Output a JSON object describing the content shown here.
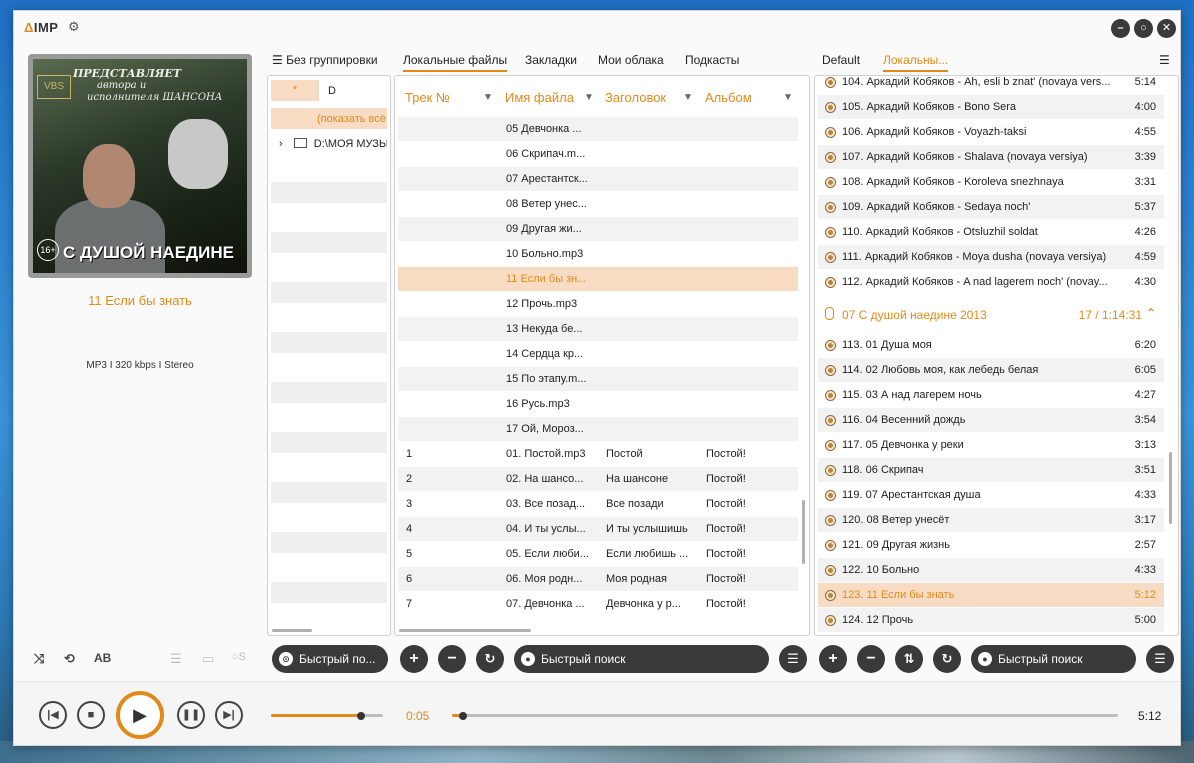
{
  "app": {
    "logo": "IMP",
    "logo_mark": "Δ"
  },
  "cover": {
    "line1": "ПРЕДСТАВЛЯЕТ",
    "line2": "автора и",
    "line3": "исполнителя ШАНСОНА",
    "brand": "VBS",
    "age": "16+",
    "title": "С ДУШОЙ НАЕДИНЕ"
  },
  "now_playing": {
    "title": "11 Если бы знать",
    "info": "MP3  I  320 kbps  I  Stereo"
  },
  "controls": {
    "ab": "AB"
  },
  "library_tabs": [
    {
      "label": "Без группировки"
    },
    {
      "label": "Локальные файлы"
    },
    {
      "label": "Закладки"
    },
    {
      "label": "Мои облака"
    },
    {
      "label": "Подкасты"
    }
  ],
  "playlist_tabs": [
    {
      "label": "Default"
    },
    {
      "label": "Локальны..."
    }
  ],
  "tree": {
    "star": "*",
    "drive": "D",
    "show_all": "(показать всё",
    "folder": "D:\\МОЯ МУЗЫ"
  },
  "file_columns": [
    {
      "label": "Трек №"
    },
    {
      "label": "Имя файла"
    },
    {
      "label": "Заголовок"
    },
    {
      "label": "Альбом"
    }
  ],
  "files": [
    {
      "track": "",
      "file": "05 Девчонка ...",
      "title": "",
      "album": ""
    },
    {
      "track": "",
      "file": "06 Скрипач.m...",
      "title": "",
      "album": ""
    },
    {
      "track": "",
      "file": "07 Арестантск...",
      "title": "",
      "album": ""
    },
    {
      "track": "",
      "file": "08 Ветер унес...",
      "title": "",
      "album": ""
    },
    {
      "track": "",
      "file": "09 Другая жи...",
      "title": "",
      "album": ""
    },
    {
      "track": "",
      "file": "10 Больно.mp3",
      "title": "",
      "album": ""
    },
    {
      "track": "",
      "file": "11 Если бы зн...",
      "title": "",
      "album": ""
    },
    {
      "track": "",
      "file": "12 Прочь.mp3",
      "title": "",
      "album": ""
    },
    {
      "track": "",
      "file": "13 Некуда бе...",
      "title": "",
      "album": ""
    },
    {
      "track": "",
      "file": "14 Сердца кр...",
      "title": "",
      "album": ""
    },
    {
      "track": "",
      "file": "15 По этапу.m...",
      "title": "",
      "album": ""
    },
    {
      "track": "",
      "file": "16 Русь.mp3",
      "title": "",
      "album": ""
    },
    {
      "track": "",
      "file": "17 Ой, Мороз...",
      "title": "",
      "album": ""
    },
    {
      "track": "1",
      "file": "01. Постой.mp3",
      "title": "Постой",
      "album": "Постой!"
    },
    {
      "track": "2",
      "file": "02. На шансо...",
      "title": "На шансоне",
      "album": "Постой!"
    },
    {
      "track": "3",
      "file": "03. Все позад...",
      "title": "Все позади",
      "album": "Постой!"
    },
    {
      "track": "4",
      "file": "04. И ты услы...",
      "title": "И ты услышишь",
      "album": "Постой!"
    },
    {
      "track": "5",
      "file": "05. Если люби...",
      "title": "Если любишь ...",
      "album": "Постой!"
    },
    {
      "track": "6",
      "file": "06. Моя родн...",
      "title": "Моя родная",
      "album": "Постой!"
    },
    {
      "track": "7",
      "file": "07. Девчонка ...",
      "title": "Девчонка у р...",
      "album": "Постой!"
    }
  ],
  "playlist": [
    {
      "title": "104. Аркадий Кобяков - Ah, esli b znat' (novaya vers...",
      "dur": "5:14"
    },
    {
      "title": "105. Аркадий Кобяков - Bono Sera",
      "dur": "4:00"
    },
    {
      "title": "106. Аркадий Кобяков - Voyazh-taksi",
      "dur": "4:55"
    },
    {
      "title": "107. Аркадий Кобяков - Shalava (novaya versiya)",
      "dur": "3:39"
    },
    {
      "title": "108. Аркадий Кобяков - Koroleva snezhnaya",
      "dur": "3:31"
    },
    {
      "title": "109. Аркадий Кобяков - Sedaya noch'",
      "dur": "5:37"
    },
    {
      "title": "110. Аркадий Кобяков - Otsluzhil soldat",
      "dur": "4:26"
    },
    {
      "title": "111. Аркадий Кобяков - Moya dusha (novaya versiya)",
      "dur": "4:59"
    },
    {
      "title": "112. Аркадий Кобяков - A nad lagerem noch' (novay...",
      "dur": "4:30"
    }
  ],
  "group": {
    "title": "07 С душой наедине 2013",
    "summary": "17 / 1:14:31"
  },
  "playlist2": [
    {
      "title": "113. 01 Душа моя",
      "dur": "6:20"
    },
    {
      "title": "114. 02 Любовь моя, как лебедь белая",
      "dur": "6:05"
    },
    {
      "title": "115. 03 А над лагерем ночь",
      "dur": "4:27"
    },
    {
      "title": "116. 04 Весенний дождь",
      "dur": "3:54"
    },
    {
      "title": "117. 05 Девчонка у реки",
      "dur": "3:13"
    },
    {
      "title": "118. 06 Скрипач",
      "dur": "3:51"
    },
    {
      "title": "119. 07 Арестантская душа",
      "dur": "4:33"
    },
    {
      "title": "120. 08 Ветер унесёт",
      "dur": "3:17"
    },
    {
      "title": "121. 09 Другая жизнь",
      "dur": "2:57"
    },
    {
      "title": "122. 10 Больно",
      "dur": "4:33"
    },
    {
      "title": "123. 11 Если бы знать",
      "dur": "5:12"
    },
    {
      "title": "124. 12 Прочь",
      "dur": "5:00"
    }
  ],
  "search": {
    "tree": "Быстрый по...",
    "files": "Быстрый поиск",
    "playlist": "Быстрый поиск"
  },
  "player": {
    "elapsed": "0:05",
    "total": "5:12",
    "volume": 0.8,
    "progress": 0.016
  },
  "accent": "#e08a1a"
}
